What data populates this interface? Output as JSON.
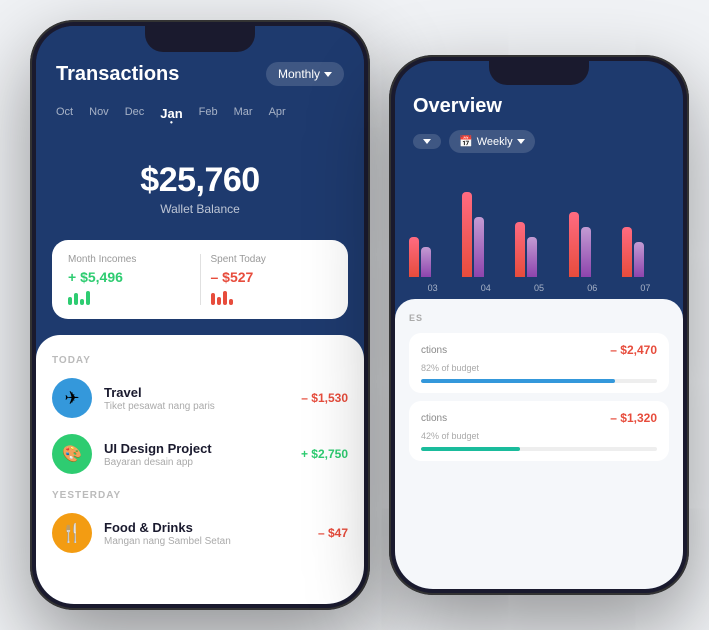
{
  "scene": {
    "bg": "#f0f2f5"
  },
  "left_phone": {
    "title": "Transactions",
    "monthly_label": "Monthly",
    "months": [
      "Oct",
      "Nov",
      "Dec",
      "Jan",
      "Feb",
      "Mar",
      "Apr"
    ],
    "active_month": "Jan",
    "balance": "$25,760",
    "balance_label": "Wallet Balance",
    "stats": {
      "income_label": "Month Incomes",
      "income_value": "+ $5,496",
      "spent_label": "Spent Today",
      "spent_value": "– $527"
    },
    "today_label": "TODAY",
    "transactions_today": [
      {
        "icon": "✈",
        "icon_color": "blue",
        "name": "Travel",
        "desc": "Tiket pesawat nang paris",
        "amount": "– $1,530",
        "amount_type": "negative"
      },
      {
        "icon": "🎨",
        "icon_color": "green",
        "name": "UI Design Project",
        "desc": "Bayaran desain app",
        "amount": "+ $2,750",
        "amount_type": "positive"
      }
    ],
    "yesterday_label": "YESTERDAY",
    "transactions_yesterday": [
      {
        "icon": "🍴",
        "icon_color": "orange",
        "name": "Food & Drinks",
        "desc": "Mangan nang Sambel Setan",
        "amount": "– $47",
        "amount_type": "negative"
      }
    ]
  },
  "right_phone": {
    "title": "Overview",
    "ctrl1": "▼",
    "weekly_label": "Weekly",
    "chart_labels": [
      "03",
      "04",
      "05",
      "06",
      "07"
    ],
    "chart_bars": [
      {
        "red": 40,
        "purple": 30
      },
      {
        "red": 75,
        "purple": 55
      },
      {
        "red": 55,
        "purple": 40
      },
      {
        "red": 60,
        "purple": 45
      },
      {
        "red": 50,
        "purple": 35
      }
    ],
    "section_label": "ES",
    "items": [
      {
        "cat": "ctions",
        "amount": "– $2,470",
        "pct_label": "82% of budget",
        "pct": 82,
        "fill": "fill-blue"
      },
      {
        "cat": "ctions",
        "amount": "– $1,320",
        "pct_label": "42% of budget",
        "pct": 42,
        "fill": "fill-cyan"
      }
    ]
  }
}
